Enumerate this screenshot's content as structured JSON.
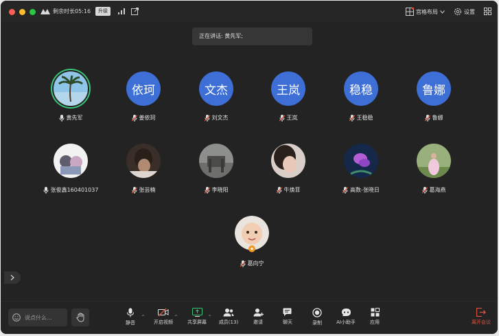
{
  "title_bar": {
    "remaining_time": "剩余时长05:16",
    "upgrade_label": "升级",
    "layout_label": "宫格布局",
    "settings_label": "设置"
  },
  "speaking": {
    "text": "正在讲话: 黄先军;"
  },
  "participants": [
    {
      "name": "黄先军",
      "avatar_type": "photo",
      "avatar_text": "",
      "mic": "on",
      "speaking": true
    },
    {
      "name": "姜依珂",
      "avatar_type": "text",
      "avatar_text": "依珂",
      "mic": "muted"
    },
    {
      "name": "刘文杰",
      "avatar_type": "text",
      "avatar_text": "文杰",
      "mic": "muted"
    },
    {
      "name": "王岚",
      "avatar_type": "text",
      "avatar_text": "王岚",
      "mic": "muted"
    },
    {
      "name": "王稳稳",
      "avatar_type": "text",
      "avatar_text": "稳稳",
      "mic": "muted"
    },
    {
      "name": "鲁娜",
      "avatar_type": "text",
      "avatar_text": "鲁娜",
      "mic": "muted"
    },
    {
      "name": "张俊鑫160401037",
      "avatar_type": "photo",
      "avatar_text": "",
      "mic": "on"
    },
    {
      "name": "张芸楠",
      "avatar_type": "photo",
      "avatar_text": "",
      "mic": "muted"
    },
    {
      "name": "李晓阳",
      "avatar_type": "photo",
      "avatar_text": "",
      "mic": "muted"
    },
    {
      "name": "牛焕菲",
      "avatar_type": "photo",
      "avatar_text": "",
      "mic": "muted"
    },
    {
      "name": "高数-张晓日",
      "avatar_type": "photo",
      "avatar_text": "",
      "mic": "muted"
    },
    {
      "name": "葛海燕",
      "avatar_type": "photo",
      "avatar_text": "",
      "mic": "muted"
    },
    {
      "name": "葛向宁",
      "avatar_type": "photo",
      "avatar_text": "",
      "mic": "muted",
      "host_badge": true
    }
  ],
  "toolbar": {
    "chat_placeholder": "说点什么...",
    "mute_label": "静音",
    "video_label": "开启视频",
    "share_label": "共享屏幕",
    "members_label": "成员(13)",
    "invite_label": "邀请",
    "chat_label": "聊天",
    "record_label": "录制",
    "ai_label": "AI小助手",
    "apps_label": "应用",
    "leave_label": "离开会议"
  },
  "colors": {
    "text_avatar_bg": "#3d6fd6",
    "speaking_ring": "#3bc47a",
    "leave_red": "#e0523e",
    "muted_red": "#e0523e"
  }
}
